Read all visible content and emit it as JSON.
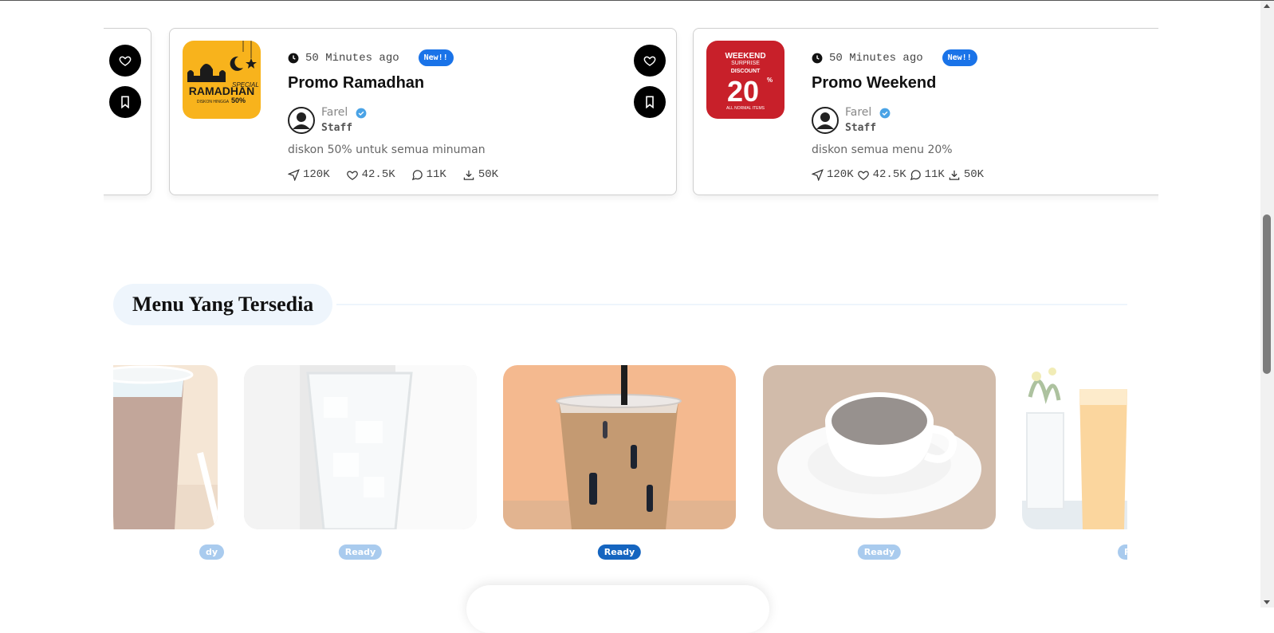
{
  "promos": [
    {
      "time": "50 Minutes ago",
      "badge": "New!!",
      "title": "Promo Ramadhan",
      "author": "Farel",
      "role": "Staff",
      "description": "diskon 50% untuk semua minuman",
      "stats": {
        "shares": "120K",
        "likes": "42.5K",
        "comments": "11K",
        "downloads": "50K"
      },
      "poster": {
        "line1": "SPECIAL",
        "line2": "RAMADHAN",
        "line3": "DISKON HINGGA",
        "line4": "50%",
        "color": "#f8b31c"
      }
    },
    {
      "time": "50 Minutes ago",
      "badge": "New!!",
      "title": "Promo Weekend",
      "author": "Farel",
      "role": "Staff",
      "description": "diskon semua menu 20%",
      "stats": {
        "shares": "120K",
        "likes": "42.5K",
        "comments": "11K",
        "downloads": "50K"
      },
      "poster": {
        "line1": "WEEKEND",
        "line2": "SURPRISE",
        "line3": "DISCOUNT",
        "line4": "20",
        "line5": "%",
        "line6": "ALL NORMAL ITEMS",
        "color": "#c8202a"
      }
    }
  ],
  "menu_section": {
    "title": "Menu Yang Tersedia",
    "items": [
      {
        "status": "Ready",
        "status_partial": "dy",
        "image": "iced-cola",
        "active": false
      },
      {
        "status": "Ready",
        "image": "iced-water",
        "active": false
      },
      {
        "status": "Ready",
        "image": "iced-coffee-milk",
        "active": true
      },
      {
        "status": "Ready",
        "image": "hot-coffee",
        "active": false
      },
      {
        "status": "Ready",
        "status_partial": "R",
        "image": "orange-juice",
        "active": false
      }
    ]
  },
  "colors": {
    "accent": "#1a73e8",
    "ready": "#1565c0",
    "ready_faded": "#a9cbee",
    "section_bg": "#eef5fc"
  }
}
